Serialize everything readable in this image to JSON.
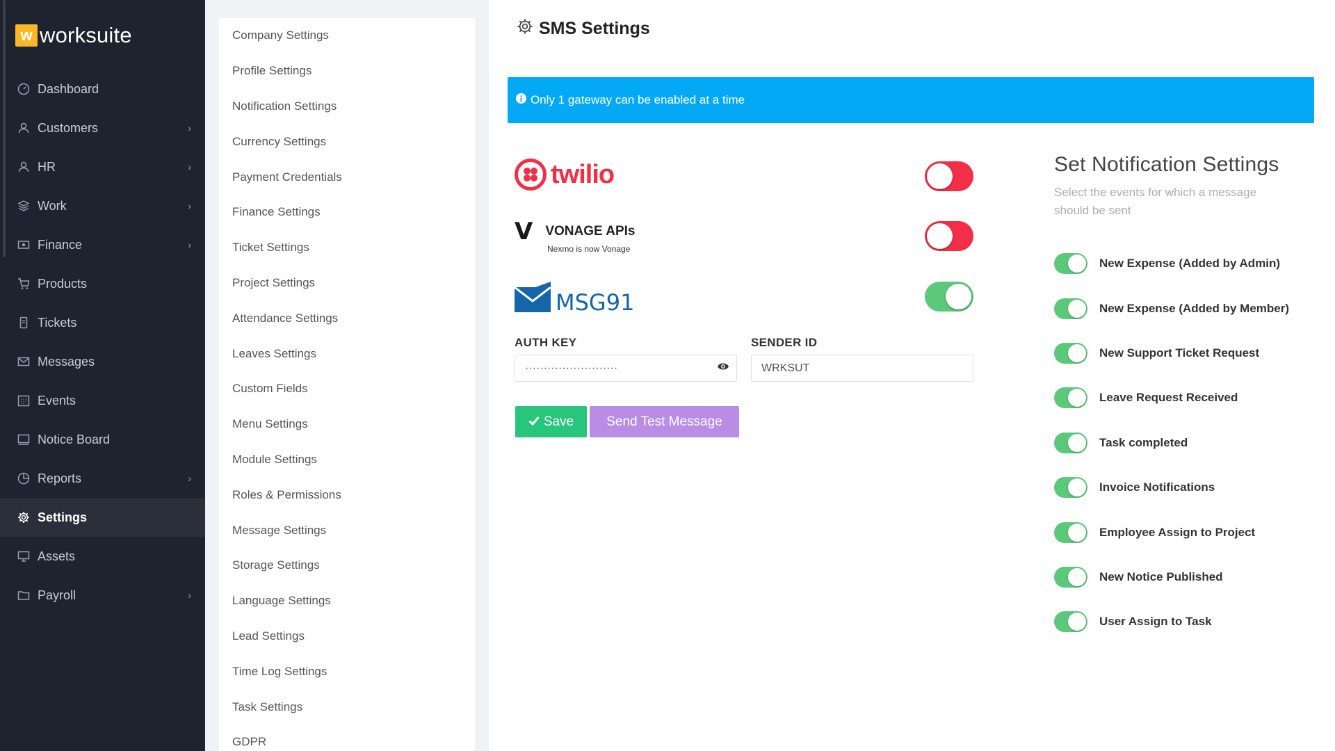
{
  "brand": {
    "mark": "w",
    "name": "worksuite",
    "accent": "#fbb726"
  },
  "sidebar": {
    "items": [
      {
        "label": "Dashboard",
        "icon": "dashboard-icon",
        "chevron": false
      },
      {
        "label": "Customers",
        "icon": "customers-icon",
        "chevron": true
      },
      {
        "label": "HR",
        "icon": "hr-icon",
        "chevron": true
      },
      {
        "label": "Work",
        "icon": "work-icon",
        "chevron": true
      },
      {
        "label": "Finance",
        "icon": "finance-icon",
        "chevron": true
      },
      {
        "label": "Products",
        "icon": "cart-icon",
        "chevron": false
      },
      {
        "label": "Tickets",
        "icon": "ticket-icon",
        "chevron": false
      },
      {
        "label": "Messages",
        "icon": "envelope-icon",
        "chevron": false
      },
      {
        "label": "Events",
        "icon": "calendar-icon",
        "chevron": false
      },
      {
        "label": "Notice Board",
        "icon": "notice-board-icon",
        "chevron": false
      },
      {
        "label": "Reports",
        "icon": "pie-chart-icon",
        "chevron": true
      },
      {
        "label": "Settings",
        "icon": "gear-icon",
        "chevron": false,
        "active": true
      },
      {
        "label": "Assets",
        "icon": "monitor-icon",
        "chevron": false
      },
      {
        "label": "Payroll",
        "icon": "folder-icon",
        "chevron": true
      }
    ]
  },
  "settings_menu": [
    "Company Settings",
    "Profile Settings",
    "Notification Settings",
    "Currency Settings",
    "Payment Credentials",
    "Finance Settings",
    "Ticket Settings",
    "Project Settings",
    "Attendance Settings",
    "Leaves Settings",
    "Custom Fields",
    "Menu Settings",
    "Module Settings",
    "Roles & Permissions",
    "Message Settings",
    "Storage Settings",
    "Language Settings",
    "Lead Settings",
    "Time Log Settings",
    "Task Settings",
    "GDPR"
  ],
  "page": {
    "title": "SMS Settings",
    "alert": "Only 1 gateway can be enabled at a time"
  },
  "gateways": {
    "twilio": {
      "logo_text": "twilio",
      "enabled": false
    },
    "vonage": {
      "logo_text": "VONAGE APIs",
      "logo_sub": "Nexmo is now Vonage",
      "enabled": false
    },
    "msg91": {
      "logo_text": "MSG91",
      "enabled": true
    }
  },
  "form": {
    "auth_key_label": "AUTH KEY",
    "auth_key_value": "·························",
    "sender_id_label": "SENDER ID",
    "sender_id_value": "WRKSUT",
    "save_label": "Save",
    "test_label": "Send Test Message"
  },
  "notifications": {
    "title": "Set Notification Settings",
    "subtitle": "Select the events for which a message should be sent",
    "items": [
      {
        "label": "New Expense (Added by Admin)",
        "enabled": true
      },
      {
        "label": "New Expense (Added by Member)",
        "enabled": true
      },
      {
        "label": "New Support Ticket Request",
        "enabled": true
      },
      {
        "label": "Leave Request Received",
        "enabled": true
      },
      {
        "label": "Task completed",
        "enabled": true
      },
      {
        "label": "Invoice Notifications",
        "enabled": true
      },
      {
        "label": "Employee Assign to Project",
        "enabled": true
      },
      {
        "label": "New Notice Published",
        "enabled": true
      },
      {
        "label": "User Assign to Task",
        "enabled": true
      }
    ]
  },
  "colors": {
    "sidebar_bg": "#1e2330",
    "alert_bg": "#03a9f4",
    "toggle_on": "#5cc87a",
    "toggle_off": "#f22f46",
    "save_button": "#28c57d",
    "test_button": "#b98ce6"
  }
}
